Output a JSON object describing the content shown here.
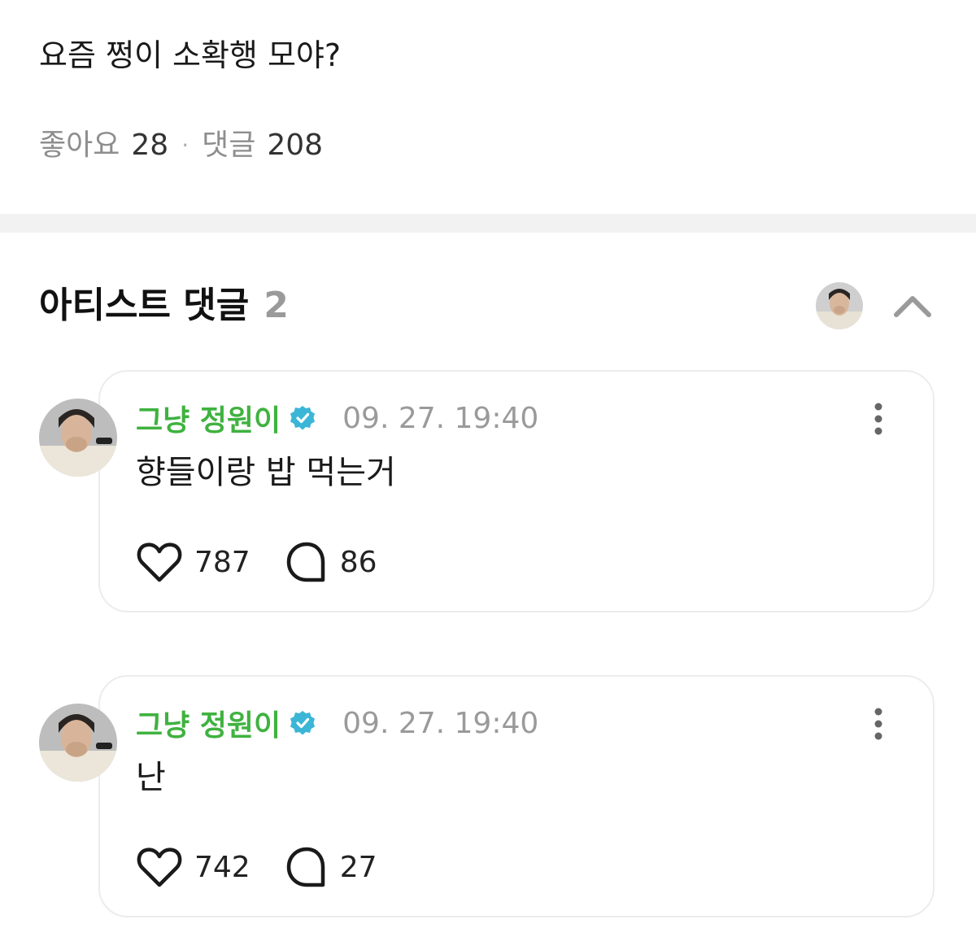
{
  "post": {
    "text": "요즘 쩡이 소확행 모야?",
    "likes_label": "좋아요",
    "likes_count": "28",
    "separator": "·",
    "comments_label": "댓글",
    "comments_count": "208"
  },
  "artist_comments": {
    "title": "아티스트 댓글",
    "count": "2",
    "collapse_icon": "chevron-up-icon",
    "items": [
      {
        "author": "그냥 정원이",
        "verified": true,
        "timestamp": "09. 27. 19:40",
        "text": "향들이랑 밥 먹는거",
        "likes": "787",
        "replies": "86"
      },
      {
        "author": "그냥 정원이",
        "verified": true,
        "timestamp": "09. 27. 19:40",
        "text": "난",
        "likes": "742",
        "replies": "27"
      }
    ]
  },
  "colors": {
    "author_green": "#3fb23f",
    "verified_blue": "#3cb6d6",
    "muted_gray": "#9a9a9a",
    "divider": "#f2f2f2"
  }
}
